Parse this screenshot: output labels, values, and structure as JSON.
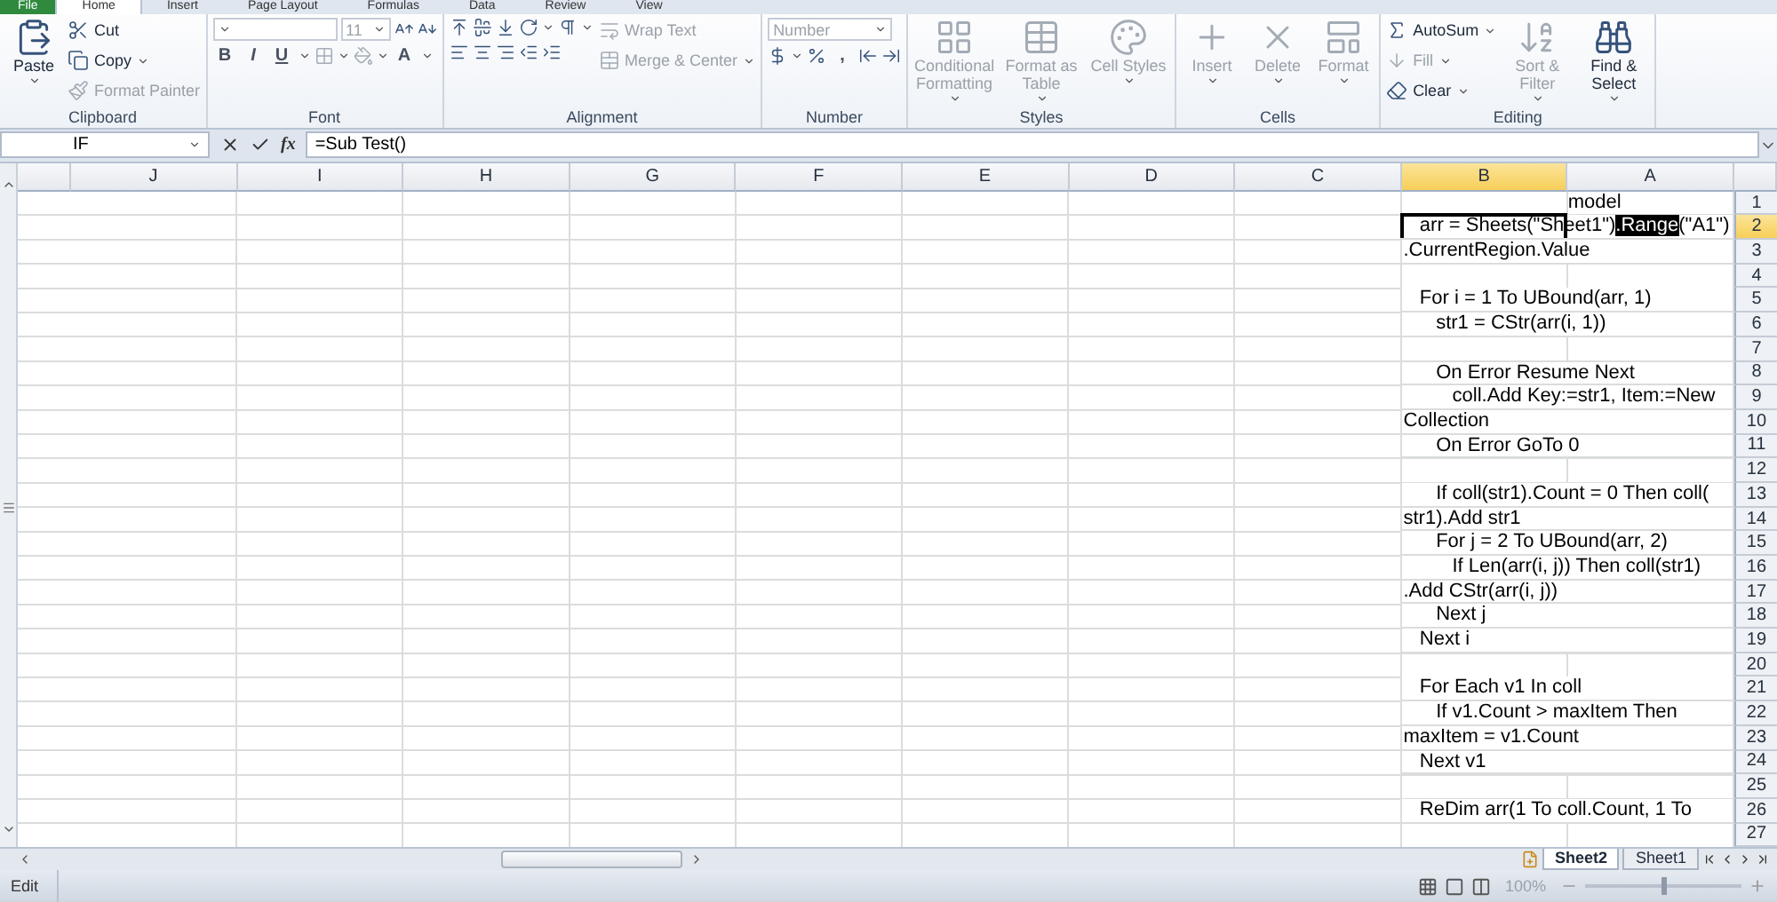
{
  "ribbon_tabs": [
    {
      "label": "File",
      "selected": false,
      "kind": "file"
    },
    {
      "label": "Home",
      "selected": true,
      "kind": "tab"
    },
    {
      "label": "Insert",
      "selected": false,
      "kind": "tab"
    },
    {
      "label": "Page Layout",
      "selected": false,
      "kind": "tab"
    },
    {
      "label": "Formulas",
      "selected": false,
      "kind": "tab"
    },
    {
      "label": "Data",
      "selected": false,
      "kind": "tab"
    },
    {
      "label": "Review",
      "selected": false,
      "kind": "tab"
    },
    {
      "label": "View",
      "selected": false,
      "kind": "tab"
    }
  ],
  "ribbon_groups": [
    {
      "title": "Clipboard",
      "columns": [
        [
          [
            {
              "kind": "large",
              "label": "Paste",
              "disabled": false,
              "dropdown": true
            }
          ]
        ],
        [
          [
            {
              "kind": "small",
              "label": "Cut",
              "disabled": false
            }
          ],
          [
            {
              "kind": "small",
              "label": "Copy",
              "disabled": false,
              "dropdown": true
            }
          ],
          [
            {
              "kind": "small",
              "label": "Format Painter",
              "disabled": true
            }
          ]
        ]
      ]
    },
    {
      "title": "Font",
      "columns": [
        [
          [
            {
              "kind": "field",
              "disabled": true,
              "dropdown": true,
              "wide": true
            },
            {
              "kind": "field",
              "label": "11",
              "disabled": true,
              "dropdown": true
            },
            {
              "kind": "icon",
              "disabled": false
            },
            {
              "kind": "icon",
              "disabled": false
            }
          ],
          [
            {
              "kind": "glyph",
              "label": "B",
              "disabled": false
            },
            {
              "kind": "glyph",
              "label": "I",
              "disabled": false
            },
            {
              "kind": "glyph",
              "label": "U",
              "disabled": false,
              "dropdown": true
            },
            {
              "kind": "icon",
              "disabled": true,
              "dropdown": true
            },
            {
              "kind": "icon",
              "disabled": true,
              "dropdown": true
            },
            {
              "kind": "glyph",
              "label": "A",
              "disabled": false,
              "dropdown": true
            }
          ]
        ]
      ]
    },
    {
      "title": "Alignment",
      "columns": [
        [
          [
            {
              "kind": "icon",
              "disabled": false
            },
            {
              "kind": "icon",
              "disabled": false
            },
            {
              "kind": "icon",
              "disabled": false
            },
            {
              "kind": "icon",
              "disabled": false,
              "dropdown": true
            },
            {
              "kind": "icon",
              "disabled": false,
              "dropdown": true
            }
          ],
          [
            {
              "kind": "icon",
              "disabled": false
            },
            {
              "kind": "icon",
              "disabled": false
            },
            {
              "kind": "icon",
              "disabled": false
            },
            {
              "kind": "icon",
              "disabled": false
            },
            {
              "kind": "icon",
              "disabled": false
            }
          ]
        ],
        [
          [
            {
              "kind": "small",
              "label": "Wrap Text",
              "disabled": true
            }
          ],
          [
            {
              "kind": "small",
              "label": "Merge & Center",
              "disabled": true,
              "dropdown": true
            }
          ]
        ]
      ]
    },
    {
      "title": "Number",
      "columns": [
        [
          [
            {
              "kind": "field",
              "label": "Number",
              "disabled": true,
              "dropdown": true,
              "wide": true
            }
          ],
          [
            {
              "kind": "icon",
              "disabled": false,
              "dropdown": true
            },
            {
              "kind": "icon",
              "disabled": false
            },
            {
              "kind": "glyph",
              "label": ",",
              "disabled": false
            },
            {
              "kind": "icon",
              "disabled": false
            },
            {
              "kind": "icon",
              "disabled": false
            }
          ]
        ]
      ]
    },
    {
      "title": "Styles",
      "columns": [
        [
          [
            {
              "kind": "large",
              "label": "Conditional Formatting",
              "disabled": true,
              "dropdown": true
            }
          ]
        ],
        [
          [
            {
              "kind": "large",
              "label": "Format as Table",
              "disabled": true,
              "dropdown": true
            }
          ]
        ],
        [
          [
            {
              "kind": "large",
              "label": "Cell Styles",
              "disabled": true,
              "dropdown": true
            }
          ]
        ]
      ]
    },
    {
      "title": "Cells",
      "columns": [
        [
          [
            {
              "kind": "large",
              "label": "Insert",
              "disabled": true,
              "dropdown": true
            }
          ]
        ],
        [
          [
            {
              "kind": "large",
              "label": "Delete",
              "disabled": true,
              "dropdown": true
            }
          ]
        ],
        [
          [
            {
              "kind": "large",
              "label": "Format",
              "disabled": true,
              "dropdown": true
            }
          ]
        ]
      ]
    },
    {
      "title": "Editing",
      "columns": [
        [
          [
            {
              "kind": "small",
              "label": "AutoSum",
              "disabled": false,
              "dropdown": true
            }
          ],
          [
            {
              "kind": "small",
              "label": "Fill",
              "disabled": true,
              "dropdown": true
            }
          ],
          [
            {
              "kind": "small",
              "label": "Clear",
              "disabled": false,
              "dropdown": true
            }
          ]
        ],
        [
          [
            {
              "kind": "large",
              "label": "Sort & Filter",
              "disabled": true,
              "dropdown": true
            }
          ]
        ],
        [
          [
            {
              "kind": "large",
              "label": "Find & Select",
              "disabled": false,
              "dropdown": true
            }
          ]
        ]
      ]
    }
  ],
  "formula_bar": {
    "name_box": "IF",
    "function_button": "fx",
    "formula": "=Sub Test()"
  },
  "columns": [
    {
      "label": "J",
      "selected": false
    },
    {
      "label": "I",
      "selected": false
    },
    {
      "label": "H",
      "selected": false
    },
    {
      "label": "G",
      "selected": false
    },
    {
      "label": "F",
      "selected": false
    },
    {
      "label": "E",
      "selected": false
    },
    {
      "label": "D",
      "selected": false
    },
    {
      "label": "C",
      "selected": false
    },
    {
      "label": "B",
      "selected": true
    },
    {
      "label": "A",
      "selected": false
    }
  ],
  "rows": [
    {
      "number": "1",
      "selected": false,
      "a": "model"
    },
    {
      "number": "2",
      "selected": true,
      "b": [
        {
          "text": "   arr = Sheets(\"Sheet1\")",
          "highlighted": false
        },
        {
          "text": ".Range",
          "highlighted": true
        },
        {
          "text": "(\"A1\")",
          "highlighted": false
        }
      ]
    },
    {
      "number": "3",
      "selected": false,
      "b": [
        {
          "text": ".CurrentRegion.Value",
          "highlighted": false
        }
      ]
    },
    {
      "number": "4",
      "selected": false
    },
    {
      "number": "5",
      "selected": false,
      "b": [
        {
          "text": "   For i = 1 To UBound(arr, 1)",
          "highlighted": false
        }
      ]
    },
    {
      "number": "6",
      "selected": false,
      "b": [
        {
          "text": "      str1 = CStr(arr(i, 1))",
          "highlighted": false
        }
      ]
    },
    {
      "number": "7",
      "selected": false
    },
    {
      "number": "8",
      "selected": false,
      "b": [
        {
          "text": "      On Error Resume Next",
          "highlighted": false
        }
      ]
    },
    {
      "number": "9",
      "selected": false,
      "b": [
        {
          "text": "         coll.Add Key:=str1, Item:=New",
          "highlighted": false
        }
      ]
    },
    {
      "number": "10",
      "selected": false,
      "b": [
        {
          "text": "Collection",
          "highlighted": false
        }
      ]
    },
    {
      "number": "11",
      "selected": false,
      "b": [
        {
          "text": "      On Error GoTo 0",
          "highlighted": false
        }
      ]
    },
    {
      "number": "12",
      "selected": false
    },
    {
      "number": "13",
      "selected": false,
      "b": [
        {
          "text": "      If coll(str1).Count = 0 Then coll(",
          "highlighted": false
        }
      ]
    },
    {
      "number": "14",
      "selected": false,
      "b": [
        {
          "text": "str1).Add str1",
          "highlighted": false
        }
      ]
    },
    {
      "number": "15",
      "selected": false,
      "b": [
        {
          "text": "      For j = 2 To UBound(arr, 2)",
          "highlighted": false
        }
      ]
    },
    {
      "number": "16",
      "selected": false,
      "b": [
        {
          "text": "         If Len(arr(i, j)) Then coll(str1)",
          "highlighted": false
        }
      ]
    },
    {
      "number": "17",
      "selected": false,
      "b": [
        {
          "text": ".Add CStr(arr(i, j))",
          "highlighted": false
        }
      ]
    },
    {
      "number": "18",
      "selected": false,
      "b": [
        {
          "text": "      Next j",
          "highlighted": false
        }
      ]
    },
    {
      "number": "19",
      "selected": false,
      "b": [
        {
          "text": "   Next i",
          "highlighted": false
        }
      ]
    },
    {
      "number": "20",
      "selected": false
    },
    {
      "number": "21",
      "selected": false,
      "b": [
        {
          "text": "   For Each v1 In coll",
          "highlighted": false
        }
      ]
    },
    {
      "number": "22",
      "selected": false,
      "b": [
        {
          "text": "      If v1.Count > maxItem Then",
          "highlighted": false
        }
      ]
    },
    {
      "number": "23",
      "selected": false,
      "b": [
        {
          "text": "maxItem = v1.Count",
          "highlighted": false
        }
      ]
    },
    {
      "number": "24",
      "selected": false,
      "b": [
        {
          "text": "   Next v1",
          "highlighted": false
        }
      ]
    },
    {
      "number": "25",
      "selected": false
    },
    {
      "number": "26",
      "selected": false,
      "b": [
        {
          "text": "   ReDim arr(1 To coll.Count, 1 To",
          "highlighted": false
        }
      ]
    },
    {
      "number": "27",
      "selected": false
    }
  ],
  "sheet_tabs": [
    {
      "label": "Sheet2",
      "selected": true
    },
    {
      "label": "Sheet1",
      "selected": false
    }
  ],
  "status_bar": {
    "mode": "Edit",
    "zoom": {
      "label": "100%",
      "level": 0.5
    }
  }
}
